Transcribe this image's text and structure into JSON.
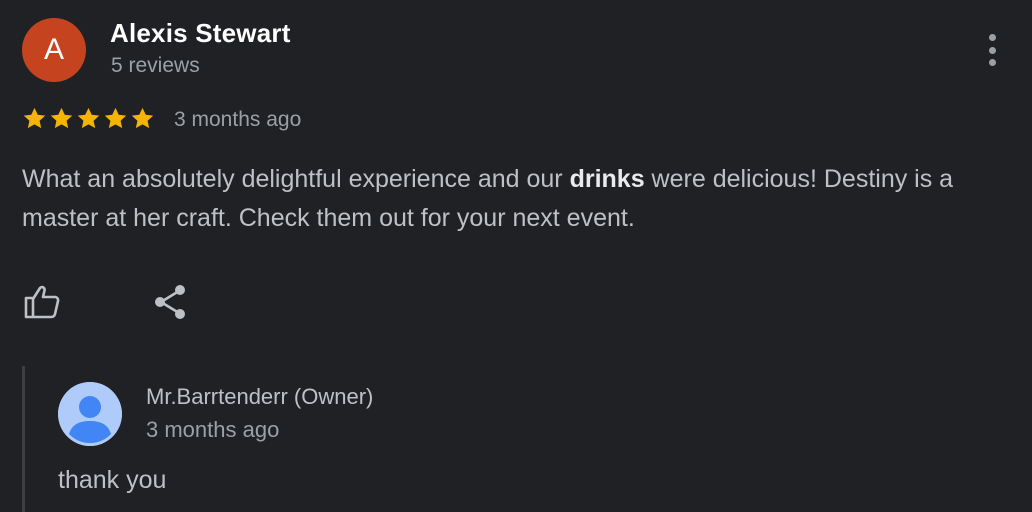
{
  "review": {
    "avatar_initial": "A",
    "avatar_color": "#c5441f",
    "reviewer_name": "Alexis Stewart",
    "review_count": "5 reviews",
    "rating": 5,
    "rating_max": 5,
    "star_color": "#f4b400",
    "time_ago": "3 months ago",
    "text_part1": "What an absolutely delightful experience and our ",
    "text_bold": "drinks",
    "text_part2": " were delicious! Destiny is a master at her craft. Check them out for your next event.",
    "more_icon": "more-vert-icon"
  },
  "actions": {
    "like_icon": "thumb-up-icon",
    "share_icon": "share-icon"
  },
  "owner_reply": {
    "avatar_icon": "person-icon",
    "name": "Mr.Barrtenderr (Owner)",
    "time_ago": "3 months ago",
    "text": "thank you"
  }
}
